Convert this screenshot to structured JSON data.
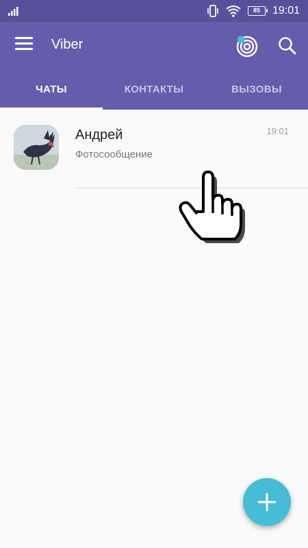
{
  "status_bar": {
    "battery": "85",
    "time": "19:01",
    "icons": [
      "signal-icon",
      "vibrate-icon",
      "wifi-icon",
      "battery-icon"
    ]
  },
  "app_bar": {
    "title": "Viber",
    "icons": [
      "menu-icon",
      "explore-icon",
      "search-icon"
    ]
  },
  "tabs": [
    {
      "label": "ЧАТЫ",
      "active": true
    },
    {
      "label": "КОНТАКТЫ",
      "active": false
    },
    {
      "label": "ВЫЗОВЫ",
      "active": false
    }
  ],
  "chats": [
    {
      "name": "Андрей",
      "subtitle": "Фотосообщение",
      "time": "19:01"
    }
  ],
  "colors": {
    "status_bar": "#59509b",
    "app_bar": "#665cac",
    "fab": "#47bcd6",
    "background": "#fafafa"
  },
  "fab": {
    "icon": "plus-icon"
  }
}
